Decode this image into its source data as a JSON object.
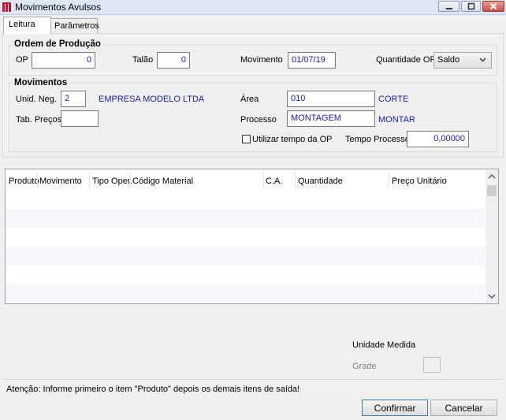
{
  "window": {
    "title": "Movimentos Avulsos"
  },
  "tabs": [
    {
      "label": "Leitura",
      "active": true
    },
    {
      "label": "Parâmetros",
      "active": false
    }
  ],
  "ordem_producao": {
    "title": "Ordem de Produção",
    "op_label": "OP",
    "op_value": "0",
    "talao_label": "Talão",
    "talao_value": "0",
    "movimento_label": "Movimento",
    "movimento_value": "01/07/19",
    "quantidade_op_label": "Quantidade OP",
    "quantidade_op_value": "Saldo"
  },
  "movimentos": {
    "title": "Movimentos",
    "unid_neg_label": "Unid. Neg.",
    "unid_neg_value": "2",
    "unid_neg_desc": "EMPRESA MODELO LTDA",
    "tab_precos_label": "Tab. Preços",
    "tab_precos_value": "",
    "area_label": "Área",
    "area_value": "010",
    "area_desc": "CORTE",
    "processo_label": "Processo",
    "processo_value": "MONTAGEM",
    "processo_desc": "MONTAR",
    "utilizar_tempo_label": "Utilizar tempo da OP",
    "utilizar_tempo_checked": false,
    "tempo_processo_label": "Tempo Processo",
    "tempo_processo_value": "0,00000"
  },
  "grid": {
    "columns": [
      "Produto",
      "Movimento",
      "Tipo Oper.",
      "Código Material",
      "C.A.",
      "Quantidade",
      "Preço Unitário"
    ],
    "rows": []
  },
  "unidade_medida": {
    "label": "Unidade Medida",
    "grade_label": "Grade",
    "grade_value": ""
  },
  "status": {
    "message": "Atenção: Informe primeiro o item \"Produto\" depois os demais itens de saída!"
  },
  "buttons": {
    "confirm": "Confirmar",
    "cancel": "Cancelar"
  },
  "colors": {
    "accent_text": "#1a1aa8",
    "title_bar": "#dce6f4",
    "row_alt": "#f5f7fa"
  }
}
